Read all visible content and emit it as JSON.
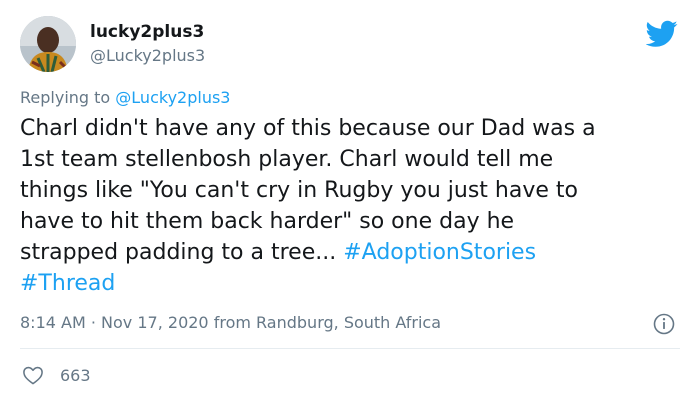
{
  "tweet": {
    "display_name": "lucky2plus3",
    "handle": "@Lucky2plus3",
    "replying_prefix": "Replying to",
    "replying_handle": "@Lucky2plus3",
    "body_lines": [
      "Charl didn't have any of this because our Dad was a",
      "1st team stellenbosh player. Charl would tell me",
      "things like \"You can't cry in Rugby you just have to",
      "have to hit them back harder\" so one day he"
    ],
    "body_line5_text": "strapped padding to a tree...",
    "hashtag_1": "#AdoptionStories",
    "hashtag_2": "#Thread",
    "time": "8:14 AM",
    "separator": "·",
    "date": "Nov 17, 2020",
    "location": "from Randburg, South Africa",
    "like_count": "663"
  },
  "icons": {
    "brand": "twitter-bird-icon",
    "info": "info-icon",
    "like": "heart-icon"
  },
  "colors": {
    "accent": "#1da1f2",
    "text": "#14171a",
    "muted": "#657786",
    "divider": "#e6ecf0"
  }
}
